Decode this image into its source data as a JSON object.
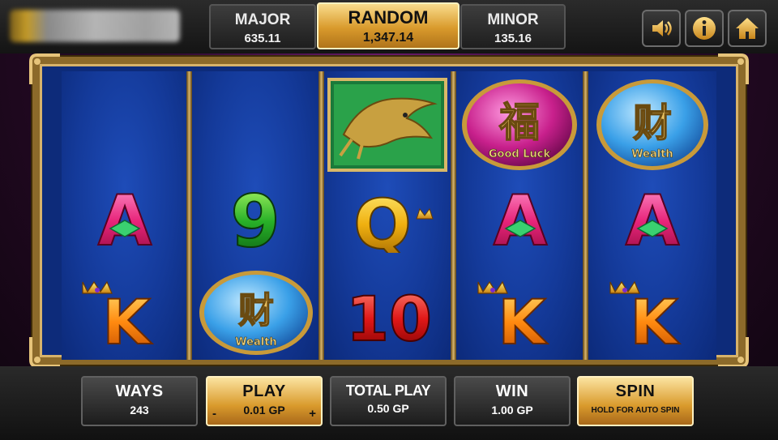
{
  "jackpots": {
    "major": {
      "name": "MAJOR",
      "value": "635.11"
    },
    "random": {
      "name": "RANDOM",
      "value": "1,347.14"
    },
    "minor": {
      "name": "MINOR",
      "value": "135.16"
    }
  },
  "top_buttons": {
    "sound_icon": "speaker-icon",
    "info_icon": "info-icon",
    "home_icon": "home-icon"
  },
  "reels": [
    {
      "symbols": [
        "blank",
        "A",
        "K"
      ]
    },
    {
      "symbols": [
        "blank",
        "9",
        "Wealth"
      ]
    },
    {
      "symbols": [
        "Koi",
        "Q",
        "10"
      ]
    },
    {
      "symbols": [
        "Good Luck",
        "A",
        "K"
      ]
    },
    {
      "symbols": [
        "Wealth",
        "A",
        "K"
      ]
    }
  ],
  "symbol_text": {
    "a": "A",
    "k": "K",
    "nine": "9",
    "q": "Q",
    "ten": "10",
    "wealth_char": "财",
    "wealth_label": "Wealth",
    "luck_char": "福",
    "luck_label": "Good Luck"
  },
  "bottom": {
    "ways": {
      "label": "WAYS",
      "value": "243"
    },
    "play": {
      "label": "PLAY",
      "value": "0.01 GP",
      "minus": "-",
      "plus": "+"
    },
    "total_play": {
      "label": "TOTAL PLAY",
      "value": "0.50 GP"
    },
    "win": {
      "label": "WIN",
      "value": "1.00 GP"
    },
    "spin": {
      "label": "SPIN",
      "sub": "HOLD FOR AUTO SPIN"
    }
  },
  "colors": {
    "gold": "#d99a2c",
    "reel_blue": "#143a9a",
    "frame_gold": "#8c6a2a"
  }
}
